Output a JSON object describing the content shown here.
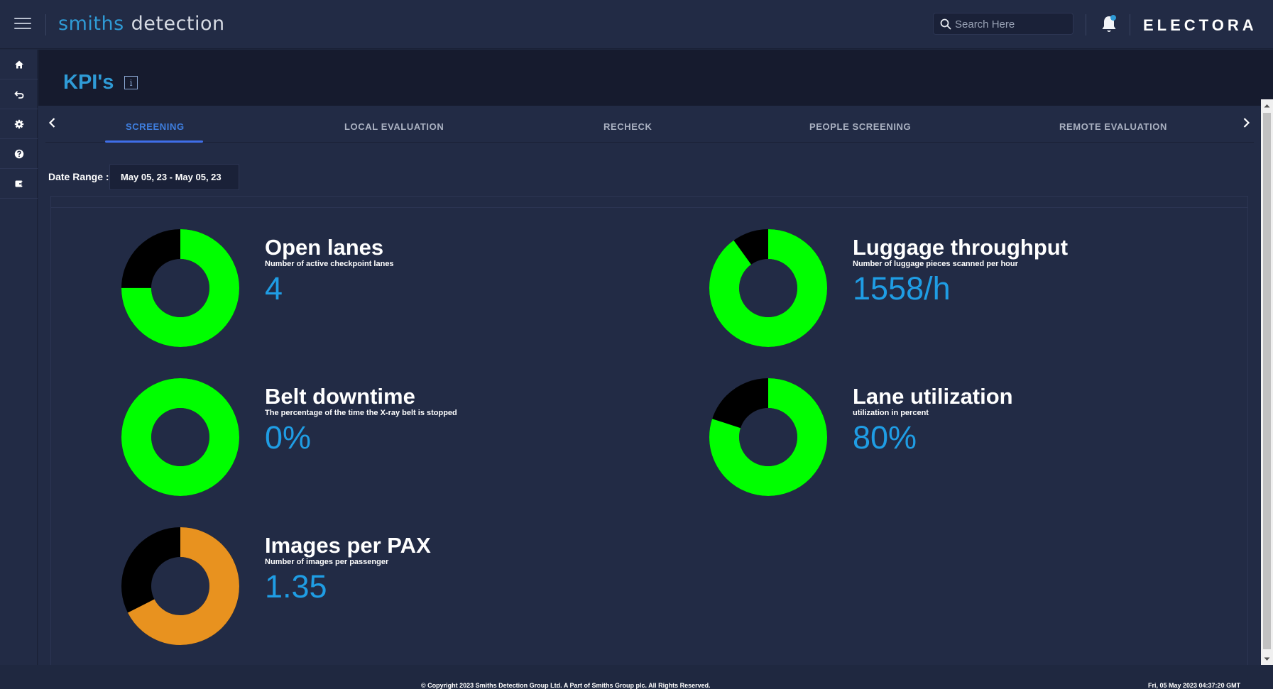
{
  "header": {
    "logo_part1": "smiths",
    "logo_part2": "detection",
    "search_placeholder": "Search Here",
    "product": "ELECTORA",
    "icons": [
      "menu-icon",
      "search-icon",
      "bell-icon"
    ]
  },
  "sidebar": {
    "items": [
      {
        "icon": "home-icon"
      },
      {
        "icon": "undo-icon"
      },
      {
        "icon": "gear-icon"
      },
      {
        "icon": "help-icon"
      },
      {
        "icon": "logout-icon"
      }
    ]
  },
  "page": {
    "title": "KPI's",
    "info_icon": "i"
  },
  "tabs": [
    {
      "label": "SCREENING",
      "active": true
    },
    {
      "label": "LOCAL EVALUATION",
      "active": false
    },
    {
      "label": "RECHECK",
      "active": false
    },
    {
      "label": "PEOPLE SCREENING",
      "active": false
    },
    {
      "label": "REMOTE EVALUATION",
      "active": false
    }
  ],
  "filters": {
    "date_label": "Date Range :",
    "date_value": "May 05, 23 - May 05, 23"
  },
  "kpis": [
    {
      "title": "Open lanes",
      "description": "Number of active checkpoint lanes",
      "value": "4",
      "fill_fraction": 0.75,
      "color": "#00ff00"
    },
    {
      "title": "Luggage throughput",
      "description": "Number of luggage pieces scanned per hour",
      "value": "1558/h",
      "fill_fraction": 0.9,
      "color": "#00ff00"
    },
    {
      "title": "Belt downtime",
      "description": "The percentage of the time the X-ray belt is stopped",
      "value": "0%",
      "fill_fraction": 1.0,
      "color": "#00ff00"
    },
    {
      "title": "Lane utilization",
      "description": "utilization in percent",
      "value": "80%",
      "fill_fraction": 0.8,
      "color": "#00ff00"
    },
    {
      "title": "Images per PAX",
      "description": "Number of images per passenger",
      "value": "1.35",
      "fill_fraction": 0.675,
      "color": "#e8921f"
    }
  ],
  "footer": {
    "copyright": "© Copyright 2023 Smiths Detection Group Ltd. A Part of Smiths Group plc. All Rights Reserved.",
    "timestamp": "Fri, 05 May 2023 04:37:20 GMT"
  },
  "colors": {
    "accent": "#2f9bd6",
    "value": "#1f9de4",
    "tab_active": "#3f7fe0",
    "ok": "#00ff00",
    "warn": "#e8921f",
    "donut_bg": "#000000"
  }
}
